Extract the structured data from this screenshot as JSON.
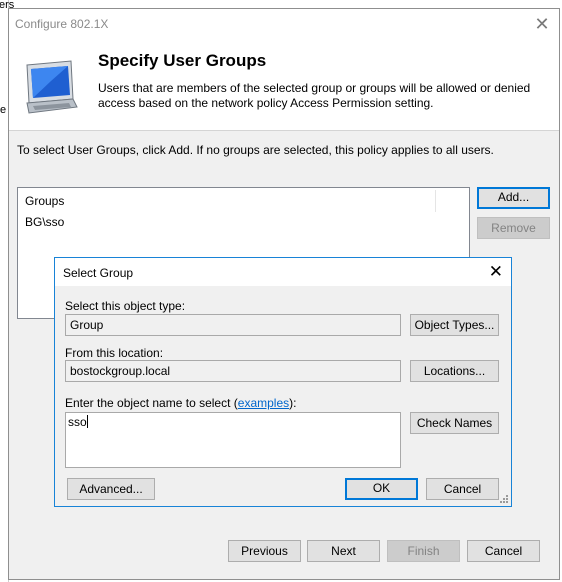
{
  "background": {
    "text_top": "ers",
    "text_left": "e"
  },
  "window": {
    "title": "Configure 802.1X",
    "close_glyph": "✕",
    "header_title": "Specify User Groups",
    "header_desc": "Users that are members of the selected group or groups will be allowed or denied access based on the network policy Access Permission setting.",
    "instruction": "To select User Groups, click Add. If no groups are selected, this policy applies to all users.",
    "groups": {
      "column": "Groups",
      "rows": [
        "BG\\sso"
      ]
    },
    "add_label": "Add...",
    "remove_label": "Remove",
    "previous_label": "Previous",
    "next_label": "Next",
    "finish_label": "Finish",
    "cancel_label": "Cancel"
  },
  "dialog": {
    "title": "Select Group",
    "close_glyph": "✕",
    "object_type_label": "Select this object type:",
    "object_type_value": "Group",
    "object_types_button": "Object Types...",
    "location_label": "From this location:",
    "location_value": "bostockgroup.local",
    "locations_button": "Locations...",
    "enter_label_prefix": "Enter the object name to select (",
    "examples_link": "examples",
    "enter_label_suffix": "):",
    "name_input_value": "sso",
    "check_names_button": "Check Names",
    "advanced_button": "Advanced...",
    "ok_button": "OK",
    "cancel_button": "Cancel"
  },
  "colors": {
    "accent": "#0078d7",
    "dialog_border": "#1883d7",
    "link": "#0066cc"
  }
}
